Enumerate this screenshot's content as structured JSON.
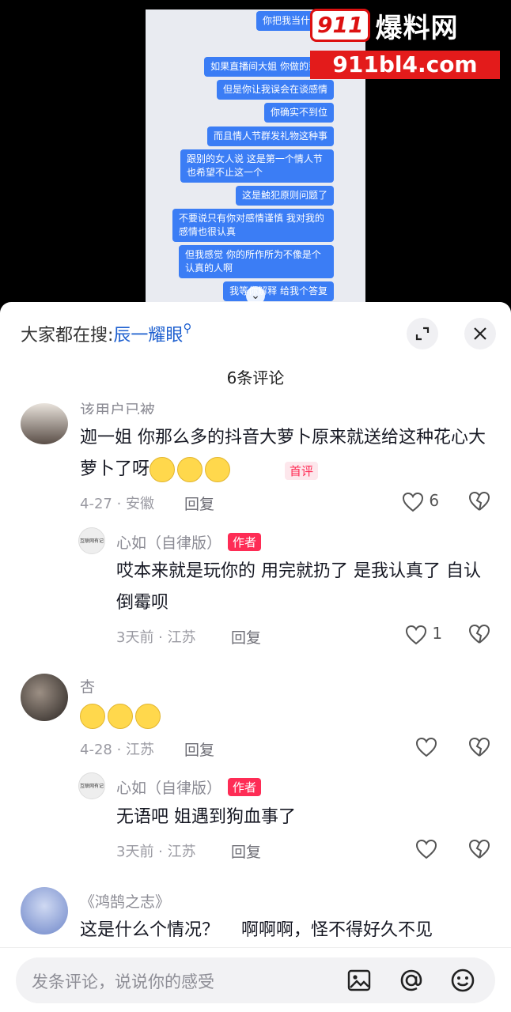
{
  "video": {
    "chat_messages": [
      "你把我当什么",
      "如果直播间大姐 你做的到位",
      "但是你让我误会在谈感情",
      "你确实不到位",
      "而且情人节群发礼物这种事",
      "跟别的女人说 这是第一个情人节也希望不止这一个",
      "这是触犯原则问题了",
      "不要说只有你对感情谨慎 我对我的感情也很认真",
      "但我感觉 你的所作所为不像是个认真的人啊",
      "我等你解释 给我个答复"
    ],
    "watermark_brand": "911",
    "watermark_text": "爆料网",
    "watermark_url": "911bl4.com"
  },
  "panel": {
    "search_prefix": "大家都在搜:",
    "search_term": "辰一耀眼",
    "comment_count": "6条评论",
    "comments": [
      {
        "nickname": "该用户已被",
        "text": "迦一姐 你那么多的抖音大萝卜原来就送给这种花心大萝卜了呀",
        "badge": "首评",
        "date_loc": "4-27 · 安徽",
        "reply_label": "回复",
        "likes": "6",
        "reply": {
          "nickname": "心如（自律版）",
          "author_tag": "作者",
          "text": "哎本来就是玩你的 用完就扔了 是我认真了 自认倒霉呗",
          "date_loc": "3天前 · 江苏",
          "reply_label": "回复",
          "likes": "1",
          "avatar_text": "互联网有记忆"
        }
      },
      {
        "nickname": "杏",
        "text": "",
        "date_loc": "4-28 · 江苏",
        "reply_label": "回复",
        "likes": "",
        "reply": {
          "nickname": "心如（自律版）",
          "author_tag": "作者",
          "text": "无语吧 姐遇到狗血事了",
          "date_loc": "3天前 · 江苏",
          "reply_label": "回复",
          "likes": "",
          "avatar_text": "互联网有记忆"
        }
      },
      {
        "nickname": "《鸿鹄之志》",
        "text": "这是什么个情况？    啊啊啊，怪不得好久不见"
      }
    ],
    "input_placeholder": "发条评论，说说你的感受"
  },
  "colors": {
    "accent_red": "#fe2c55",
    "search_blue": "#1d5fcf",
    "bubble_blue": "#3b7df5"
  }
}
